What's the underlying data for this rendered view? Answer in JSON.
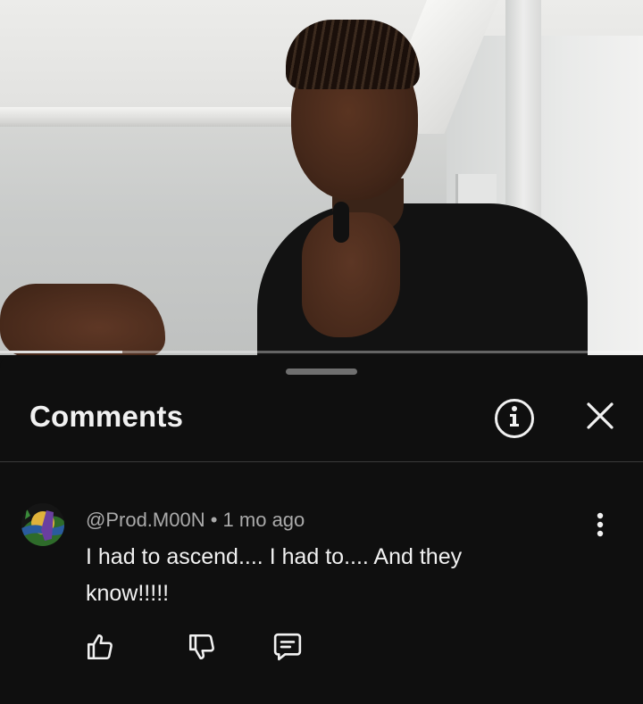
{
  "video": {
    "progress_fraction": 0.19
  },
  "comments_panel": {
    "title": "Comments",
    "info_icon": "info-circle-icon",
    "close_icon": "close-icon"
  },
  "comment": {
    "author_handle": "@Prod.M00N",
    "separator": " • ",
    "timestamp": "1 mo ago",
    "text": "I had to ascend.... I had to.... And they know!!!!!",
    "avatar_icon": "user-avatar",
    "more_icon": "more-vert-icon",
    "actions": {
      "like_icon": "thumbs-up-icon",
      "dislike_icon": "thumbs-down-icon",
      "reply_icon": "reply-comment-icon"
    }
  }
}
